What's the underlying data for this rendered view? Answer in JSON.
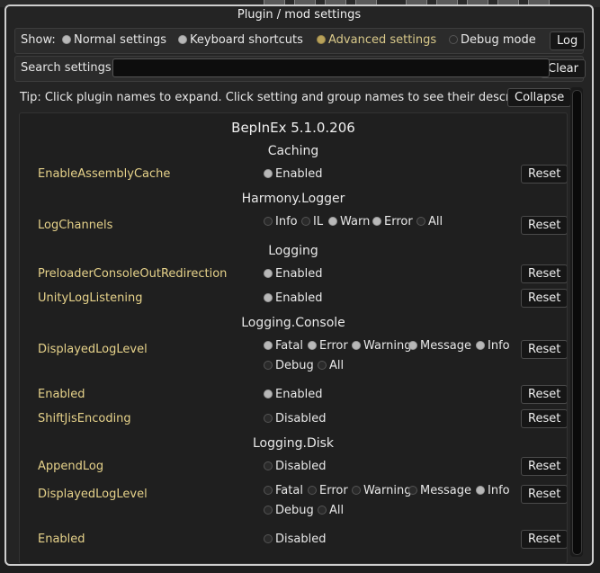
{
  "window_title": "Plugin / mod settings",
  "show": {
    "label": "Show:",
    "options": [
      "Normal settings",
      "Keyboard shortcuts",
      "Advanced settings",
      "Debug mode"
    ],
    "log_button": "Log"
  },
  "search": {
    "label": "Search settings:",
    "value": "",
    "clear_button": "Clear"
  },
  "tip": {
    "text": "Tip: Click plugin names to expand. Click setting and group names to see their descriptions.",
    "collapse_button": "Collapse"
  },
  "plugin": {
    "name": "BepInEx 5.1.0.206"
  },
  "reset_label": "Reset",
  "groups": {
    "caching": "Caching",
    "harmony": "Harmony.Logger",
    "logging": "Logging",
    "console": "Logging.Console",
    "disk": "Logging.Disk"
  },
  "settings": {
    "enable_assembly_cache": {
      "name": "EnableAssemblyCache",
      "options": [
        "Enabled"
      ]
    },
    "log_channels": {
      "name": "LogChannels",
      "options": [
        "Info",
        "IL",
        "Warn",
        "Error",
        "All"
      ]
    },
    "preloader_redirection": {
      "name": "PreloaderConsoleOutRedirection",
      "options": [
        "Enabled"
      ]
    },
    "unity_log_listening": {
      "name": "UnityLogListening",
      "options": [
        "Enabled"
      ]
    },
    "console_displayed_level": {
      "name": "DisplayedLogLevel",
      "options": [
        "Fatal",
        "Error",
        "Warning",
        "Message",
        "Info",
        "Debug",
        "All"
      ]
    },
    "console_enabled": {
      "name": "Enabled",
      "options": [
        "Enabled"
      ]
    },
    "shift_jis": {
      "name": "ShiftJisEncoding",
      "options": [
        "Disabled"
      ]
    },
    "append_log": {
      "name": "AppendLog",
      "options": [
        "Disabled"
      ]
    },
    "disk_displayed_level": {
      "name": "DisplayedLogLevel",
      "options": [
        "Fatal",
        "Error",
        "Warning",
        "Message",
        "Info",
        "Debug",
        "All"
      ]
    },
    "disk_enabled": {
      "name": "Enabled",
      "options": [
        "Disabled"
      ]
    }
  }
}
